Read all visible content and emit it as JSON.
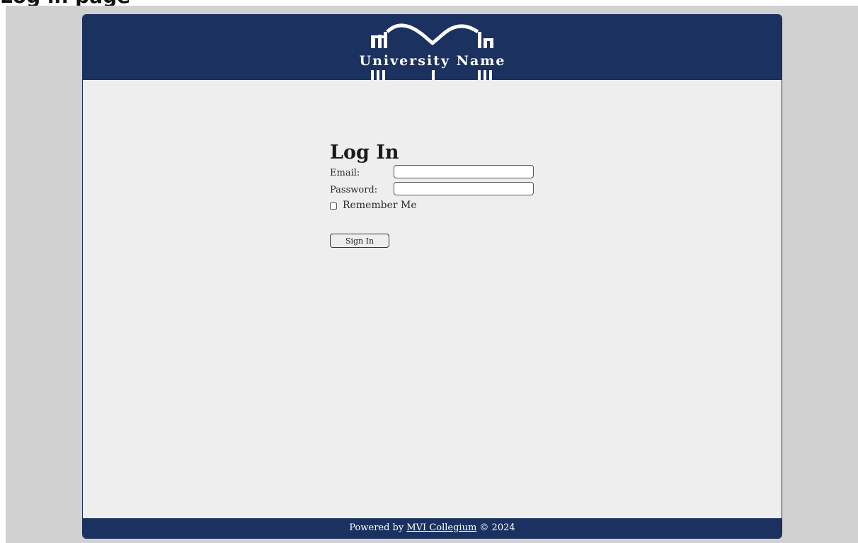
{
  "page_title_partial": "Log in page",
  "brand": {
    "name": "University Name",
    "header_color": "#1b3160",
    "logo_icon": "university-arch-logo-icon"
  },
  "login": {
    "title": "Log In",
    "email_label": "Email:",
    "email_value": "",
    "password_label": "Password:",
    "password_value": "",
    "remember_label": "Remember Me",
    "remember_checked": false,
    "submit_label": "Sign In"
  },
  "footer": {
    "prefix": "Powered by ",
    "link_text": "MVI Collegium",
    "suffix": " © 2024"
  }
}
